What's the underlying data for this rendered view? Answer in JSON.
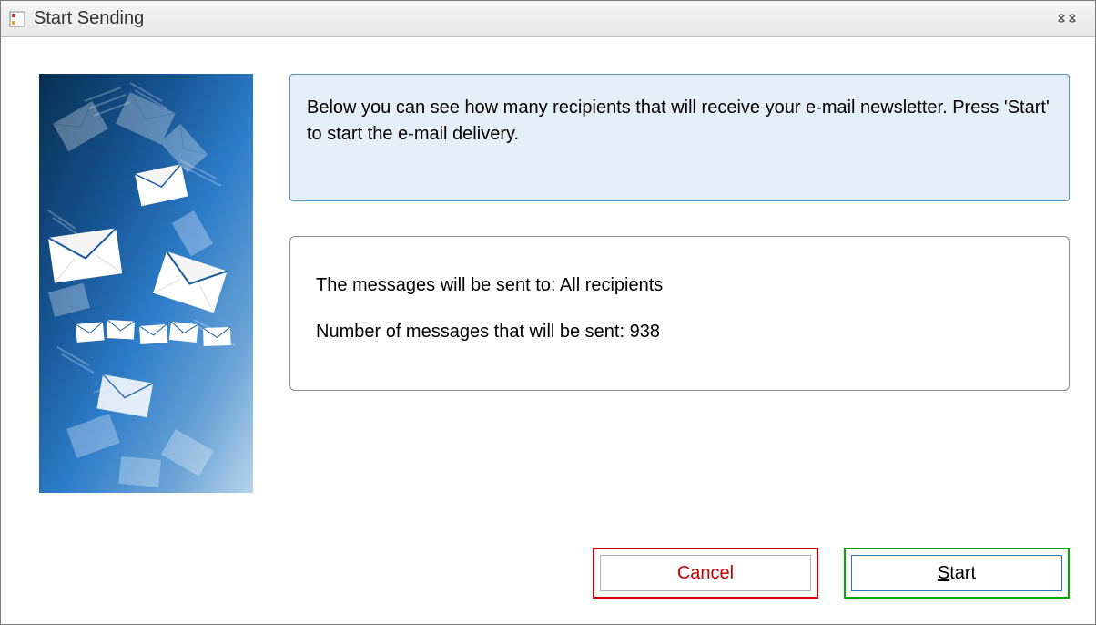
{
  "window": {
    "title": "Start Sending"
  },
  "instruction": "Below you can see how many recipients that will receive your e-mail newsletter. Press 'Start' to start the e-mail delivery.",
  "info": {
    "recipients_label": "The messages will be sent to:",
    "recipients_value": "All recipients",
    "count_label": "Number of messages that will be sent:",
    "count_value": "938"
  },
  "buttons": {
    "cancel": "Cancel",
    "start": "Start"
  }
}
